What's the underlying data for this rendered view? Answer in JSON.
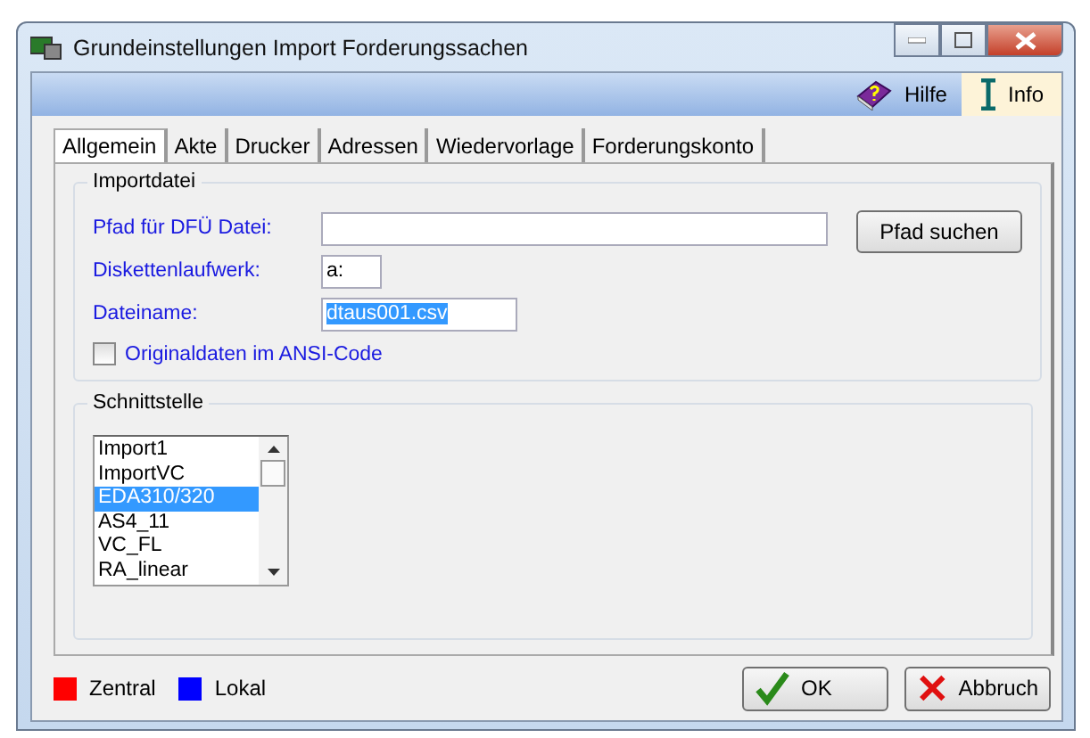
{
  "window": {
    "title": "Grundeinstellungen Import Forderungssachen"
  },
  "toolbar": [
    {
      "label": "Hilfe",
      "kind": "help",
      "selected": false
    },
    {
      "label": "Info",
      "kind": "info",
      "selected": true
    }
  ],
  "tabs": [
    {
      "label": "Allgemein",
      "selected": true
    },
    {
      "label": "Akte",
      "selected": false
    },
    {
      "label": "Drucker",
      "selected": false
    },
    {
      "label": "Adressen",
      "selected": false
    },
    {
      "label": "Wiedervorlage",
      "selected": false
    },
    {
      "label": "Forderungskonto",
      "selected": false
    }
  ],
  "importdatei": {
    "title": "Importdatei",
    "fields": [
      {
        "label": "Pfad für DFÜ Datei:"
      },
      {
        "label": "Diskettenlaufwerk:",
        "value": "a:",
        "value_selected": false
      },
      {
        "label": "Dateiname:",
        "value": "dtaus001.csv",
        "value_selected": true
      }
    ],
    "browse_button": "Pfad suchen",
    "checkbox": {
      "label": "Originaldaten im ANSI-Code",
      "checked": false
    }
  },
  "schnittstelle": {
    "title": "Schnittstelle",
    "items": [
      {
        "label": "Import1",
        "selected": false
      },
      {
        "label": "ImportVC",
        "selected": false
      },
      {
        "label": "EDA310/320",
        "selected": true
      },
      {
        "label": "AS4_11",
        "selected": false
      },
      {
        "label": "VC_FL",
        "selected": false
      },
      {
        "label": "RA_linear",
        "selected": false
      }
    ]
  },
  "legend": [
    {
      "label": "Zentral",
      "color": "#ff0000"
    },
    {
      "label": "Lokal",
      "color": "#0000ff"
    }
  ],
  "buttons": [
    {
      "label": "OK",
      "kind": "ok"
    },
    {
      "label": "Abbruch",
      "kind": "cancel"
    }
  ]
}
